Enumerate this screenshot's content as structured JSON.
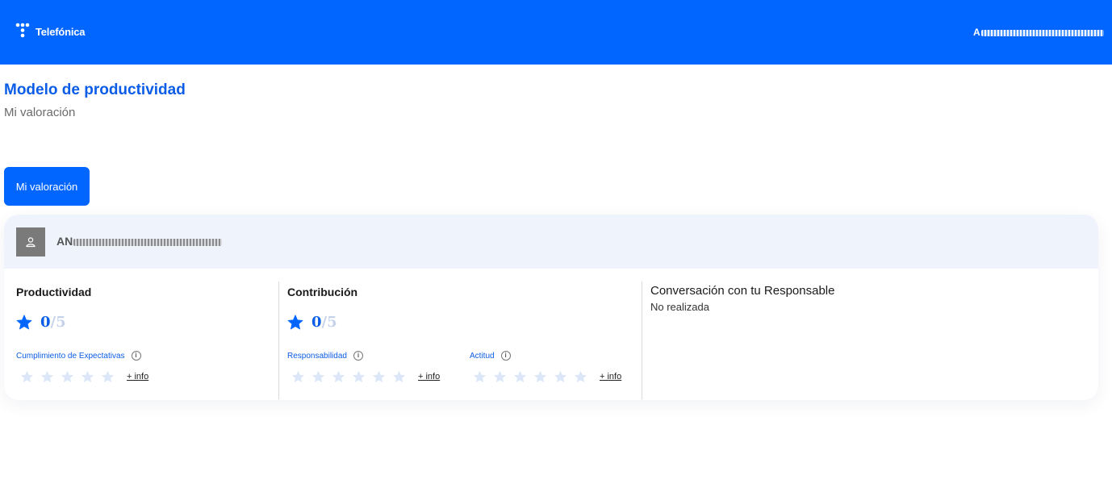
{
  "header": {
    "brand": "Telefónica",
    "user_visible_prefix": "A"
  },
  "page": {
    "title": "Modelo de productividad",
    "subtitle": "Mi valoración"
  },
  "tabs": [
    {
      "label": "Mi valoración",
      "active": true
    }
  ],
  "employee": {
    "name_visible_prefix": "AN"
  },
  "sections": {
    "productividad": {
      "title": "Productividad",
      "score": "0",
      "max": "/5",
      "criteria": [
        {
          "label": "Cumplimiento de Expectativas",
          "rating": 0,
          "more": "+ info"
        }
      ]
    },
    "contribucion": {
      "title": "Contribución",
      "score": "0",
      "max": "/5",
      "criteria": [
        {
          "label": "Responsabilidad",
          "rating": 0,
          "more": "+ info"
        },
        {
          "label": "Actitud",
          "rating": 0,
          "more": "+ info"
        }
      ]
    },
    "conversacion": {
      "title": "Conversación con tu Responsable",
      "status": "No realizada"
    }
  },
  "icons": {
    "info": "i"
  },
  "colors": {
    "brand_blue": "#0066ff",
    "title_blue": "#0b5ce6",
    "header_band": "#eff3fc",
    "empty_star": "#dbe6f8"
  }
}
